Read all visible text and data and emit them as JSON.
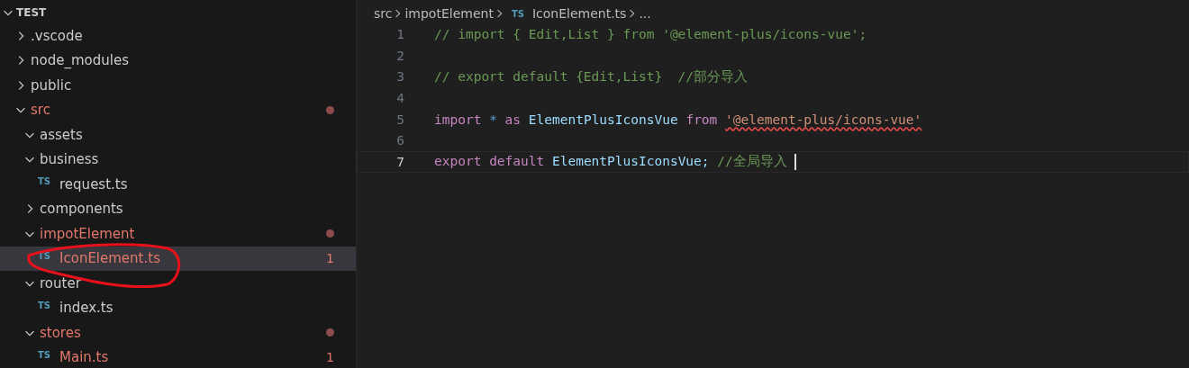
{
  "explorer": {
    "title": "TEST",
    "expanded": true,
    "items": [
      {
        "kind": "folder",
        "label": ".vscode",
        "expanded": false,
        "modified": false
      },
      {
        "kind": "folder",
        "label": "node_modules",
        "expanded": false,
        "modified": false
      },
      {
        "kind": "folder",
        "label": "public",
        "expanded": false,
        "modified": false
      },
      {
        "kind": "folder",
        "label": "src",
        "expanded": true,
        "modified": true,
        "children": [
          {
            "kind": "folder",
            "label": "assets",
            "expanded": true,
            "modified": false
          },
          {
            "kind": "folder",
            "label": "business",
            "expanded": true,
            "modified": false,
            "children": [
              {
                "kind": "file",
                "icon": "TS",
                "label": "request.ts",
                "selected": false,
                "modified": false,
                "circled": false
              }
            ]
          },
          {
            "kind": "folder",
            "label": "components",
            "expanded": false,
            "modified": false
          },
          {
            "kind": "folder",
            "label": "impotElement",
            "expanded": true,
            "modified": true,
            "children": [
              {
                "kind": "file",
                "icon": "TS",
                "label": "IconElement.ts",
                "selected": true,
                "modified": true,
                "badge": "1",
                "circled": true
              }
            ]
          },
          {
            "kind": "folder",
            "label": "router",
            "expanded": true,
            "modified": false,
            "children": [
              {
                "kind": "file",
                "icon": "TS",
                "label": "index.ts",
                "selected": false,
                "modified": false,
                "circled": false
              }
            ]
          },
          {
            "kind": "folder",
            "label": "stores",
            "expanded": true,
            "modified": true,
            "children": [
              {
                "kind": "file",
                "icon": "TS",
                "label": "Main.ts",
                "selected": false,
                "modified": true,
                "badge": "1",
                "circled": false
              }
            ]
          }
        ]
      }
    ]
  },
  "breadcrumb": [
    {
      "kind": "folder",
      "label": "src"
    },
    {
      "kind": "folder",
      "label": "impotElement"
    },
    {
      "kind": "file",
      "icon": "TS",
      "label": "IconElement.ts"
    },
    {
      "kind": "more",
      "label": "..."
    }
  ],
  "editor": {
    "lines": [
      {
        "number": "1",
        "current": false,
        "tokens": [
          {
            "kind": "comment",
            "text": "// import { Edit,List } from '@element-plus/icons-vue';"
          }
        ]
      },
      {
        "number": "2",
        "current": false
      },
      {
        "number": "3",
        "current": false,
        "tokens": [
          {
            "kind": "comment",
            "text": "// export default {Edit,List}  //部分导入"
          }
        ]
      },
      {
        "number": "4",
        "current": false
      },
      {
        "number": "5",
        "current": false,
        "tokens": [
          {
            "kind": "keyword",
            "text": "import"
          },
          {
            "kind": "operator",
            "text": "*"
          },
          {
            "kind": "keyword",
            "text": "as"
          },
          {
            "kind": "variable",
            "text": "ElementPlusIconsVue"
          },
          {
            "kind": "keyword",
            "text": "from"
          },
          {
            "kind": "string-error",
            "text": "'@element-plus/icons-vue'"
          }
        ]
      },
      {
        "number": "6",
        "current": false
      },
      {
        "number": "7",
        "current": true,
        "cursor": true,
        "tokens": [
          {
            "kind": "keyword",
            "text": "export"
          },
          {
            "kind": "keyword",
            "text": "default"
          },
          {
            "kind": "variable",
            "text": "ElementPlusIconsVue;"
          },
          {
            "kind": "comment",
            "text": "//全局导入"
          }
        ]
      }
    ]
  }
}
